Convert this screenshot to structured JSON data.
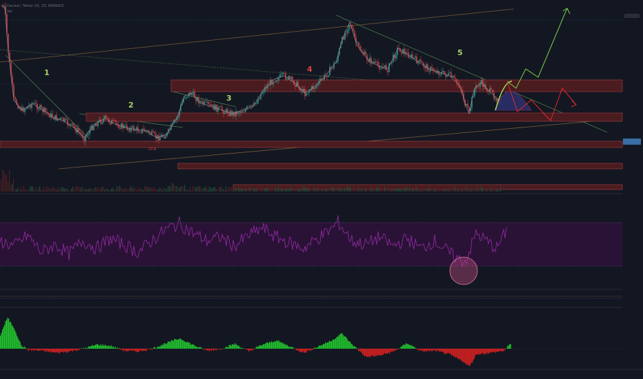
{
  "header": {
    "symbol_line": "Decred / Tether US, 1D, BINANCE",
    "sub": "Vol"
  },
  "toggle_label": "",
  "colors": {
    "background": "#131722",
    "zone_fill": "#4a1b1f",
    "zone_stroke": "#8a3a3a",
    "rsi_band": "#2a1236",
    "rsi_line": "#8b2a9b",
    "hist_up": "#22c22e",
    "hist_down": "#d42020",
    "forecast_green": "#7ad04a",
    "forecast_red": "#e02a2a",
    "candle_up": "#3aa39b",
    "candle_down": "#e04a4a"
  },
  "waves": [
    {
      "label": "1",
      "color": "#a6d36a"
    },
    {
      "label": "2",
      "color": "#a6d36a"
    },
    {
      "label": "3",
      "color": "#a6d36a"
    },
    {
      "label": "4",
      "color": "#e04040"
    },
    {
      "label": "5",
      "color": "#a6d36a"
    }
  ],
  "annotation": {
    "text": "23.8"
  },
  "price_axis_ticks": [
    "",
    "",
    "",
    "",
    "",
    "",
    "",
    "",
    "",
    "",
    "",
    ""
  ],
  "rsi_axis_ticks": [
    "",
    "",
    "",
    "",
    "",
    "",
    ""
  ],
  "macd_axis_ticks": [
    "",
    "",
    "",
    "",
    ""
  ],
  "time_axis_ticks": [
    "",
    "",
    "",
    "",
    "",
    "",
    "",
    "",
    "",
    "",
    "",
    "",
    "",
    "",
    "",
    "",
    "",
    "",
    "",
    "",
    "",
    "",
    ""
  ],
  "chart_data": [
    {
      "type": "line",
      "title": "",
      "panel": "price",
      "series": [
        {
          "x": [
            0,
            5,
            10,
            18,
            30,
            45,
            60,
            75,
            90,
            105,
            120,
            135,
            150,
            165,
            180,
            195,
            210,
            225,
            240,
            255,
            265,
            275,
            290,
            305,
            320,
            335,
            350,
            365,
            380,
            395,
            410,
            425,
            440,
            455,
            470,
            485,
            495,
            505,
            515,
            530,
            545,
            560,
            575,
            590,
            605,
            620,
            635,
            650,
            665,
            672,
            678,
            685,
            695,
            705,
            715,
            725
          ],
          "values": [
            8,
            12,
            75,
            145,
            160,
            150,
            160,
            170,
            175,
            185,
            200,
            180,
            172,
            180,
            185,
            188,
            190,
            200,
            195,
            170,
            140,
            135,
            150,
            155,
            160,
            165,
            160,
            155,
            130,
            115,
            110,
            120,
            135,
            125,
            110,
            90,
            55,
            32,
            65,
            85,
            95,
            100,
            70,
            80,
            90,
            100,
            105,
            110,
            125,
            150,
            165,
            130,
            120,
            130,
            140,
            150
          ]
        }
      ]
    },
    {
      "type": "line",
      "title": "",
      "panel": "rsi",
      "series": [
        {
          "x": [
            0,
            20,
            40,
            60,
            80,
            100,
            120,
            140,
            160,
            180,
            200,
            220,
            240,
            260,
            280,
            300,
            320,
            340,
            360,
            380,
            400,
            420,
            440,
            460,
            480,
            490,
            510,
            530,
            550,
            570,
            590,
            610,
            630,
            650,
            665,
            675,
            690,
            705,
            720,
            735
          ],
          "values": [
            55,
            48,
            62,
            40,
            50,
            38,
            55,
            45,
            58,
            50,
            40,
            55,
            70,
            78,
            65,
            55,
            60,
            48,
            62,
            72,
            60,
            52,
            45,
            58,
            70,
            80,
            55,
            50,
            60,
            48,
            58,
            45,
            55,
            40,
            30,
            28,
            65,
            55,
            45,
            70
          ]
        }
      ]
    },
    {
      "type": "bar",
      "title": "",
      "panel": "macd-histogram",
      "series": [
        {
          "x": [
            0,
            10,
            20,
            30,
            40,
            60,
            80,
            100,
            120,
            140,
            160,
            180,
            200,
            220,
            240,
            260,
            280,
            300,
            320,
            340,
            360,
            380,
            400,
            420,
            440,
            460,
            480,
            495,
            510,
            530,
            550,
            570,
            590,
            610,
            630,
            650,
            670,
            680,
            690,
            710,
            730,
            740
          ],
          "values": [
            20,
            45,
            30,
            5,
            -2,
            -3,
            -6,
            -4,
            0,
            6,
            4,
            -3,
            -4,
            0,
            8,
            15,
            5,
            -3,
            0,
            7,
            -4,
            6,
            12,
            3,
            -6,
            3,
            12,
            22,
            6,
            -12,
            -10,
            -4,
            8,
            -4,
            -3,
            -8,
            -18,
            -26,
            -8,
            -6,
            -3,
            8
          ]
        }
      ]
    }
  ]
}
